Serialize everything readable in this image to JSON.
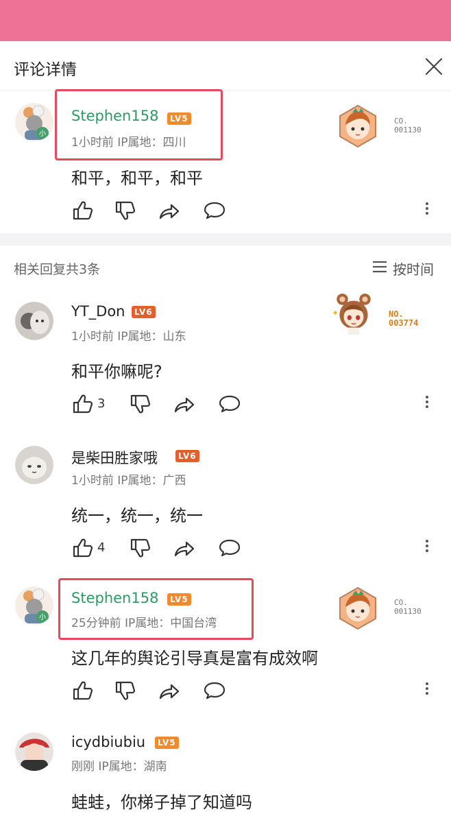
{
  "header": {
    "title": "评论详情"
  },
  "main_comment": {
    "username": "Stephen158",
    "level": "LV5",
    "meta": "1小时前 IP属地：四川",
    "content": "和平，和平，和平",
    "badge_text_1": "CO.",
    "badge_text_2": "001130"
  },
  "replies_header": {
    "count_text": "相关回复共3条",
    "sort_label": "按时间"
  },
  "replies": [
    {
      "username": "YT_Don",
      "level": "LV6",
      "meta": "1小时前 IP属地：山东",
      "content": "和平你嘛呢?",
      "likes": "3",
      "badge_text_1": "NO.",
      "badge_text_2": "003774"
    },
    {
      "username": "是柴田胜家哦",
      "level": "LV6",
      "meta": "1小时前 IP属地：广西",
      "content": "统一，统一，统一",
      "likes": "4"
    },
    {
      "username": "Stephen158",
      "level": "LV5",
      "meta": "25分钟前 IP属地：中国台湾",
      "content": "这几年的舆论引导真是富有成效啊",
      "badge_text_1": "CO.",
      "badge_text_2": "001130"
    },
    {
      "username": "icydbiubiu",
      "level": "LV5",
      "meta": "刚刚 IP属地：湖南",
      "content": "蛙蛙，你梯子掉了知道吗"
    }
  ],
  "colors": {
    "topbar": "#ec7296",
    "vip_name": "#2e9a63",
    "highlight_box": "#e8485d",
    "level_badge": "#e35f2b"
  }
}
